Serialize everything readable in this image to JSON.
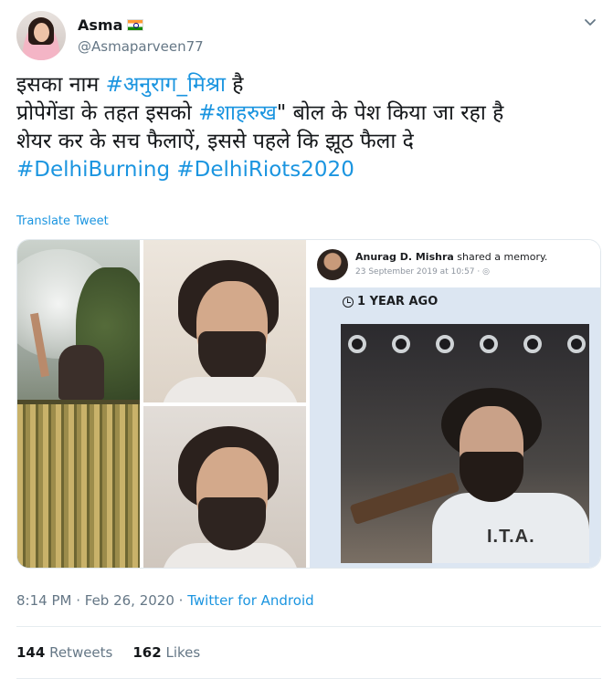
{
  "user": {
    "name": "Asma",
    "handle": "@Asmaparveen77",
    "flag_icon": "india-flag-icon"
  },
  "tweet": {
    "lines": [
      {
        "text_before": "इसका नाम ",
        "hashtag": "#अनुराग_मिश्रा",
        "text_after": " है"
      },
      {
        "text_before": "प्रोपेगेंडा के तहत इसको ",
        "hashtag": "#शाहरुख",
        "text_after": "\" बोल के पेश किया जा रहा है"
      },
      {
        "text": "शेयर कर के सच फैलाऐं, इससे पहले कि झूठ फैला दे"
      },
      {
        "hashtags": [
          "#DelhiBurning",
          "#DelhiRiots2020"
        ]
      }
    ],
    "translate_label": "Translate Tweet"
  },
  "media": {
    "memory_card": {
      "author": "Anurag D. Mishra",
      "action": " shared a memory.",
      "date": "23 September 2019 at 10:57 · ",
      "ago_label": "1 YEAR AGO",
      "shirt_text": "I.T.A."
    }
  },
  "footer": {
    "time": "8:14 PM",
    "separator": " · ",
    "date": "Feb 26, 2020",
    "source_separator": " · ",
    "source": "Twitter for Android"
  },
  "stats": {
    "retweets_count": "144",
    "retweets_label": " Retweets",
    "likes_count": "162",
    "likes_label": " Likes"
  },
  "colors": {
    "link": "#1b95e0",
    "text": "#14171a",
    "muted": "#657786"
  }
}
